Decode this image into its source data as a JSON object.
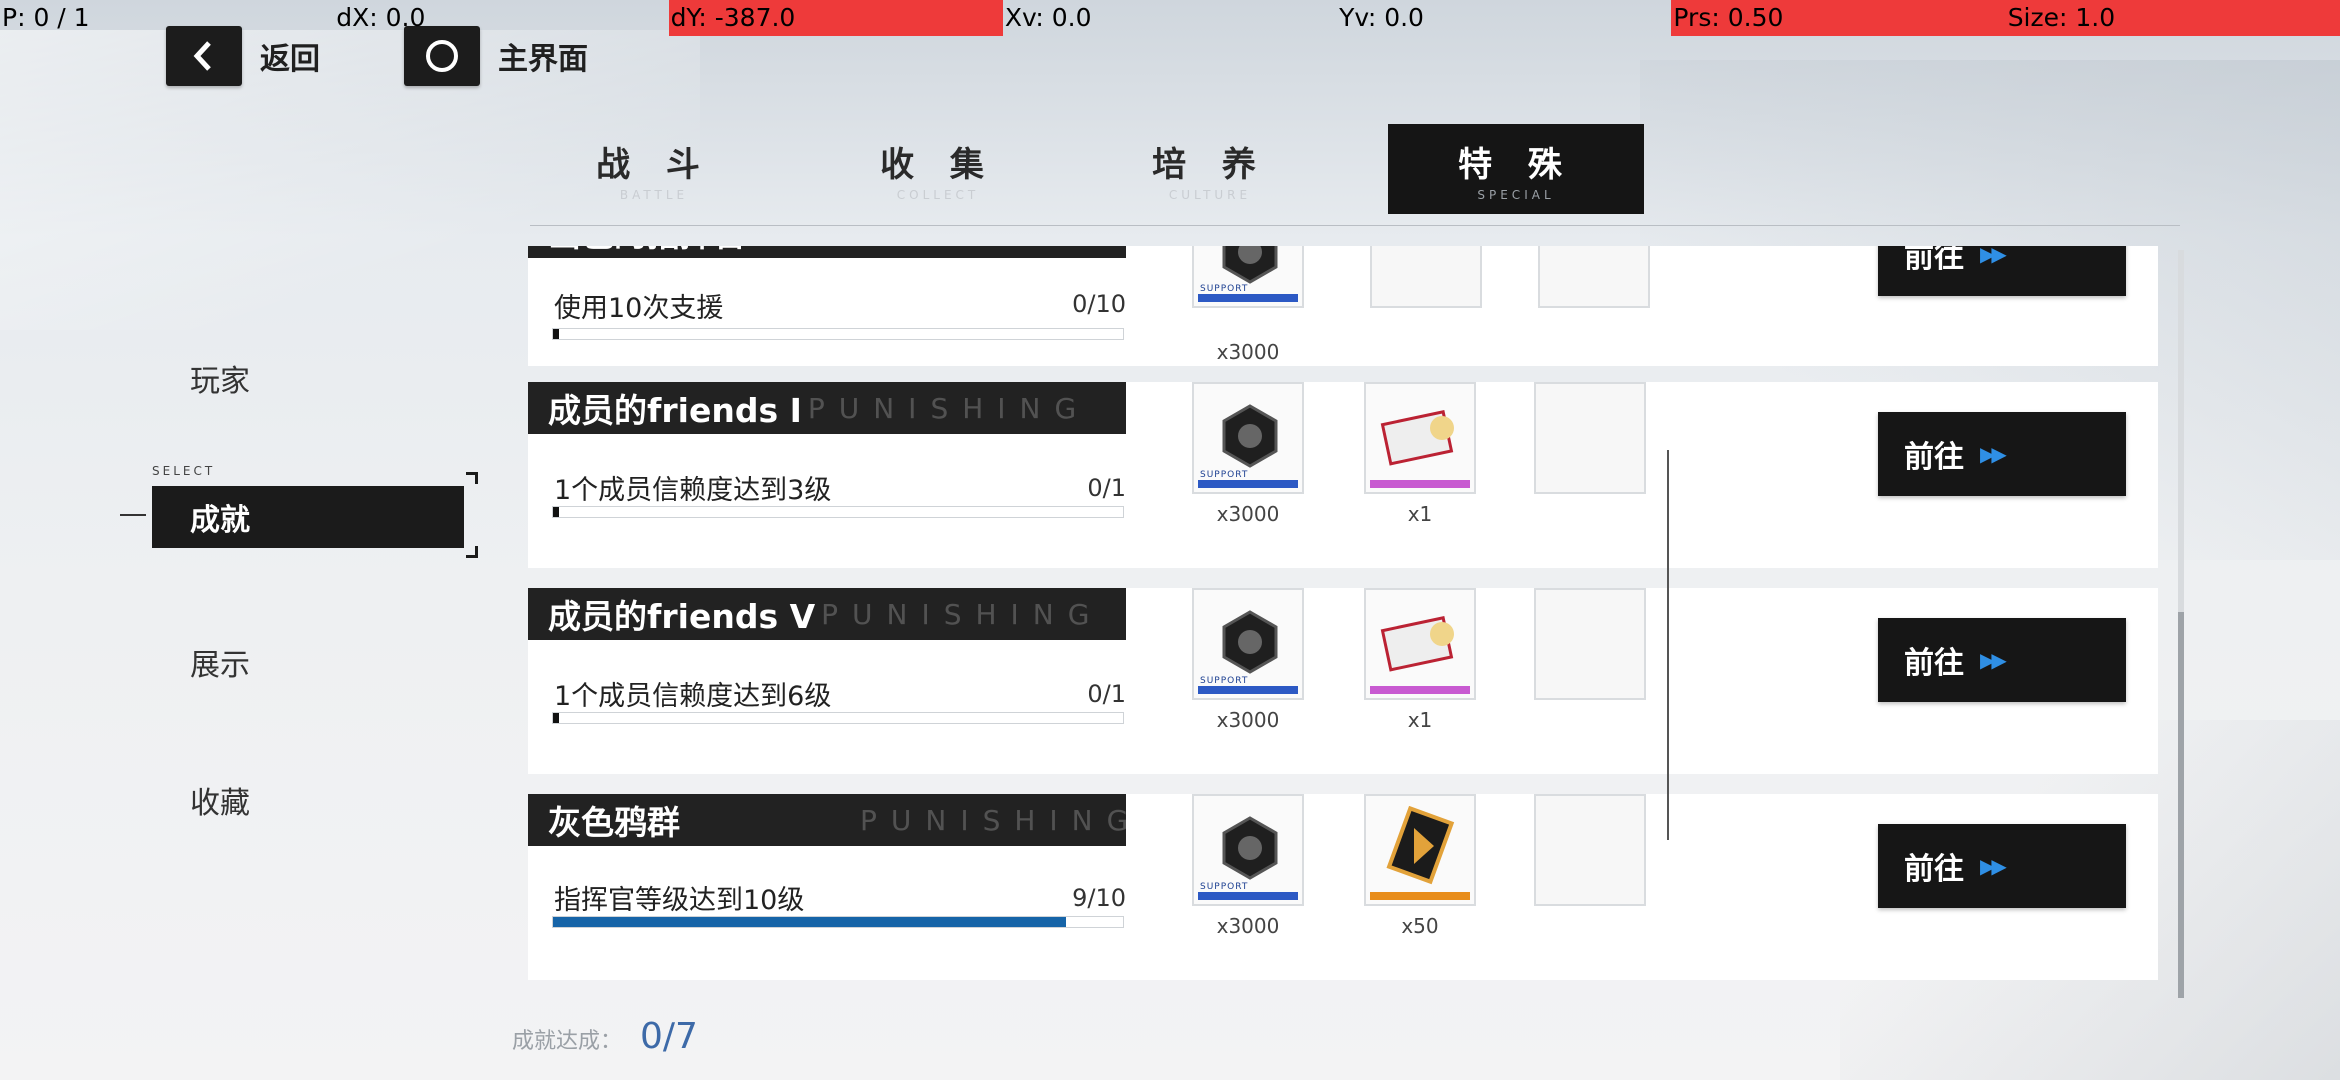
{
  "debug": {
    "p": "P: 0 / 1",
    "dx": "dX: 0.0",
    "dy": "dY: -387.0",
    "xv": "Xv: 0.0",
    "yv": "Yv: 0.0",
    "prs": "Prs: 0.50",
    "size": "Size: 1.0"
  },
  "nav": {
    "back_label": "返回",
    "home_label": "主界面"
  },
  "tabs": [
    {
      "label": "战 斗",
      "sub": "BATTLE",
      "active": false
    },
    {
      "label": "收 集",
      "sub": "COLLECT",
      "active": false
    },
    {
      "label": "培 养",
      "sub": "CULTURE",
      "active": false
    },
    {
      "label": "特 殊",
      "sub": "SPECIAL",
      "active": true
    }
  ],
  "side_menu": {
    "items": [
      "玩家",
      "成就",
      "展示",
      "收藏"
    ],
    "active": "成就",
    "select_tag": "SELECT"
  },
  "achievements": [
    {
      "title": "出色的指挥官 I",
      "watermark": "",
      "task": "使用10次支援",
      "progress_text": "0/10",
      "progress": 0.0,
      "rewards": [
        {
          "icon": "gear-nut-icon",
          "qty": "x3000",
          "rarity_color": "#2c59c4"
        }
      ],
      "empty_slots": 2,
      "button": "前往"
    },
    {
      "title": "成员的friends I",
      "watermark": "PUNISHING",
      "task": "1个成员信赖度达到3级",
      "progress_text": "0/1",
      "progress": 0.0,
      "rewards": [
        {
          "icon": "gear-nut-icon",
          "qty": "x3000",
          "rarity_color": "#2c59c4"
        },
        {
          "icon": "gift-box-icon",
          "qty": "x1",
          "rarity_color": "#c85ad1"
        }
      ],
      "empty_slots": 1,
      "button": "前往"
    },
    {
      "title": "成员的friends V",
      "watermark": "PUNISHING",
      "task": "1个成员信赖度达到6级",
      "progress_text": "0/1",
      "progress": 0.0,
      "rewards": [
        {
          "icon": "gear-nut-icon",
          "qty": "x3000",
          "rarity_color": "#2c59c4"
        },
        {
          "icon": "gift-box-icon",
          "qty": "x1",
          "rarity_color": "#c85ad1"
        }
      ],
      "empty_slots": 1,
      "button": "前往"
    },
    {
      "title": "灰色鸦群",
      "watermark": "PUNISHING",
      "task": "指挥官等级达到10级",
      "progress_text": "9/10",
      "progress": 0.9,
      "rewards": [
        {
          "icon": "gear-nut-icon",
          "qty": "x3000",
          "rarity_color": "#2c59c4"
        },
        {
          "icon": "black-card-icon",
          "qty": "x50",
          "rarity_color": "#e88d1b"
        }
      ],
      "empty_slots": 0,
      "button": "前往"
    }
  ],
  "summary": {
    "label": "成就达成：",
    "value": "0/7"
  },
  "colors": {
    "accent_blue": "#1664a8",
    "arrow_blue": "#2f8fe5",
    "debug_red": "#ee3a3a"
  }
}
